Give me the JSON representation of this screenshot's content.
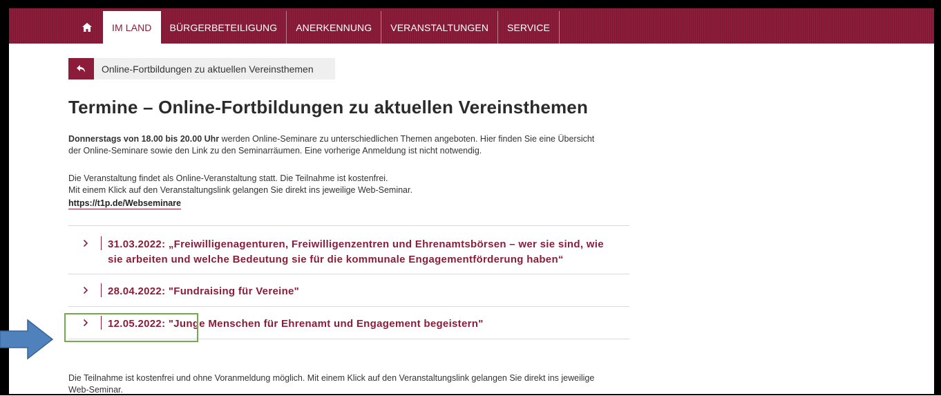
{
  "nav": {
    "home_icon": "home-icon",
    "items": [
      {
        "label": "IM LAND",
        "active": true
      },
      {
        "label": "BÜRGERBETEILIGUNG"
      },
      {
        "label": "ANERKENNUNG"
      },
      {
        "label": "VERANSTALTUNGEN"
      },
      {
        "label": "SERVICE"
      }
    ]
  },
  "breadcrumb": {
    "back_icon": "back-arrow-icon",
    "label": "Online-Fortbildungen zu aktuellen Vereinsthemen"
  },
  "page": {
    "title": "Termine – Online-Fortbildungen zu aktuellen Vereinsthemen",
    "intro_bold": "Donnerstags von 18.00 bis 20.00 Uhr",
    "intro_rest": " werden Online-Seminare zu unterschiedlichen Themen angeboten. Hier finden Sie eine Übersicht der Online-Seminare sowie den Link zu den Seminarräumen. Eine vorherige Anmeldung ist nicht notwendig.",
    "info_line1": "Die Veranstaltung findet als Online-Veranstaltung statt. Die Teilnahme ist kostenfrei.",
    "info_line2": "Mit einem Klick auf den Veranstaltungslink gelangen Sie direkt ins jeweilige Web-Seminar.",
    "link": "https://t1p.de/Webseminare",
    "footer_text": "Die Teilnahme ist kostenfrei und ohne Voranmeldung möglich. Mit einem Klick auf den Veranstaltungslink gelangen Sie direkt ins jeweilige Web-Seminar."
  },
  "events": [
    {
      "title": "31.03.2022: „Freiwilligenagenturen, Freiwilligenzentren und Ehrenamtsbörsen – wer sie sind, wie sie arbeiten und welche Bedeutung sie für die kommunale Engagementförderung haben“"
    },
    {
      "title": "28.04.2022: \"Fundraising für Vereine\""
    },
    {
      "title": "12.05.2022: \"Junge Menschen für Ehrenamt und Engagement begeistern\""
    }
  ],
  "colors": {
    "brand": "#8b1c3a",
    "annotation_box": "#70ad47",
    "annotation_arrow": "#4a7ebb"
  }
}
